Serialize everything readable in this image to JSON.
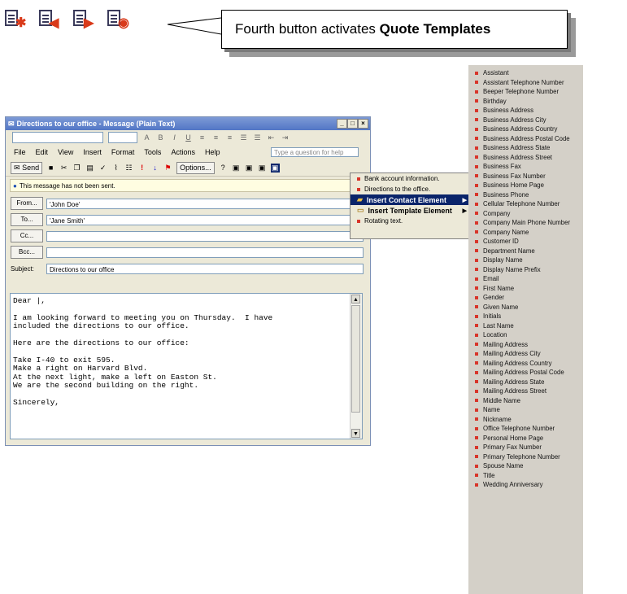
{
  "toolbar_icons": [
    {
      "name": "new-template-icon",
      "mark": "✱"
    },
    {
      "name": "import-template-icon",
      "mark": "◀"
    },
    {
      "name": "export-template-icon",
      "mark": "▶"
    },
    {
      "name": "quote-templates-icon",
      "mark": "◉"
    }
  ],
  "callout": {
    "text_prefix": "Fourth button activates ",
    "text_bold": "Quote Templates"
  },
  "window": {
    "title": "Directions to our office - Message (Plain Text)",
    "menu": [
      "File",
      "Edit",
      "View",
      "Insert",
      "Format",
      "Tools",
      "Actions",
      "Help"
    ],
    "ask_placeholder": "Type a question for help",
    "send_label": "Send",
    "options_label": "Options...",
    "notice": "This message has not been sent.",
    "from_label": "From...",
    "from_value": "'John Doe'",
    "to_label": "To...",
    "to_value": "'Jane Smith'",
    "cc_label": "Cc...",
    "bcc_label": "Bcc...",
    "subject_label": "Subject:",
    "subject_value": "Directions to our office",
    "body": "Dear |,\n\nI am looking forward to meeting you on Thursday.  I have\nincluded the directions to our office.\n\nHere are the directions to our office:\n\nTake I-40 to exit 595.\nMake a right on Harvard Blvd.\nAt the next light, make a left on Easton St.\nWe are the second building on the right.\n\nSincerely,"
  },
  "popup_menu": [
    {
      "label": "Bank account information.",
      "style": "normal"
    },
    {
      "label": "Directions to the office.",
      "style": "normal"
    },
    {
      "label": "Insert Contact Element",
      "style": "selected"
    },
    {
      "label": "Insert Template Element",
      "style": "bold"
    },
    {
      "label": "Rotating text.",
      "style": "normal"
    }
  ],
  "contact_fields": [
    "Assistant",
    "Assistant Telephone Number",
    "Beeper Telephone Number",
    "Birthday",
    "Business Address",
    "Business Address City",
    "Business Address Country",
    "Business Address Postal Code",
    "Business Address State",
    "Business Address Street",
    "Business Fax",
    "Business Fax Number",
    "Business Home Page",
    "Business Phone",
    "Cellular Telephone Number",
    "Company",
    "Company Main Phone Number",
    "Company Name",
    "Customer ID",
    "Department Name",
    "Display Name",
    "Display Name Prefix",
    "Email",
    "First Name",
    "Gender",
    "Given Name",
    "Initials",
    "Last Name",
    "Location",
    "Mailing Address",
    "Mailing Address City",
    "Mailing Address Country",
    "Mailing Address Postal Code",
    "Mailing Address State",
    "Mailing Address Street",
    "Middle Name",
    "Name",
    "Nickname",
    "Office Telephone Number",
    "Personal Home Page",
    "Primary Fax Number",
    "Primary Telephone Number",
    "Spouse Name",
    "Title",
    "Wedding Anniversary"
  ]
}
